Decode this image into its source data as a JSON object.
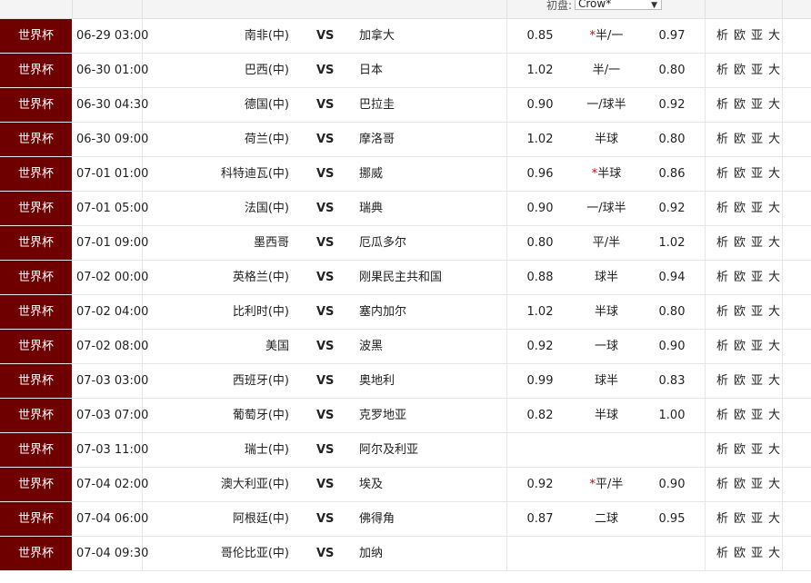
{
  "header": {
    "initial_label": "初盘:",
    "company_select": "Crow*"
  },
  "link_labels": [
    "析",
    "欧",
    "亚",
    "大"
  ],
  "vs_label": "VS",
  "matches": [
    {
      "league": "世界杯",
      "time": "06-29 03:00",
      "home": "南非(中)",
      "away": "加拿大",
      "odds_home": "0.85",
      "handicap": "半/一",
      "handicap_star": "*",
      "odds_away": "0.97"
    },
    {
      "league": "世界杯",
      "time": "06-30 01:00",
      "home": "巴西(中)",
      "away": "日本",
      "odds_home": "1.02",
      "handicap": "半/一",
      "handicap_star": "",
      "odds_away": "0.80"
    },
    {
      "league": "世界杯",
      "time": "06-30 04:30",
      "home": "德国(中)",
      "away": "巴拉圭",
      "odds_home": "0.90",
      "handicap": "一/球半",
      "handicap_star": "",
      "odds_away": "0.92"
    },
    {
      "league": "世界杯",
      "time": "06-30 09:00",
      "home": "荷兰(中)",
      "away": "摩洛哥",
      "odds_home": "1.02",
      "handicap": "半球",
      "handicap_star": "",
      "odds_away": "0.80"
    },
    {
      "league": "世界杯",
      "time": "07-01 01:00",
      "home": "科特迪瓦(中)",
      "away": "挪威",
      "odds_home": "0.96",
      "handicap": "半球",
      "handicap_star": "*",
      "odds_away": "0.86"
    },
    {
      "league": "世界杯",
      "time": "07-01 05:00",
      "home": "法国(中)",
      "away": "瑞典",
      "odds_home": "0.90",
      "handicap": "一/球半",
      "handicap_star": "",
      "odds_away": "0.92"
    },
    {
      "league": "世界杯",
      "time": "07-01 09:00",
      "home": "墨西哥",
      "away": "厄瓜多尔",
      "odds_home": "0.80",
      "handicap": "平/半",
      "handicap_star": "",
      "odds_away": "1.02"
    },
    {
      "league": "世界杯",
      "time": "07-02 00:00",
      "home": "英格兰(中)",
      "away": "刚果民主共和国",
      "odds_home": "0.88",
      "handicap": "球半",
      "handicap_star": "",
      "odds_away": "0.94"
    },
    {
      "league": "世界杯",
      "time": "07-02 04:00",
      "home": "比利时(中)",
      "away": "塞内加尔",
      "odds_home": "1.02",
      "handicap": "半球",
      "handicap_star": "",
      "odds_away": "0.80"
    },
    {
      "league": "世界杯",
      "time": "07-02 08:00",
      "home": "美国",
      "away": "波黑",
      "odds_home": "0.92",
      "handicap": "一球",
      "handicap_star": "",
      "odds_away": "0.90"
    },
    {
      "league": "世界杯",
      "time": "07-03 03:00",
      "home": "西班牙(中)",
      "away": "奥地利",
      "odds_home": "0.99",
      "handicap": "球半",
      "handicap_star": "",
      "odds_away": "0.83"
    },
    {
      "league": "世界杯",
      "time": "07-03 07:00",
      "home": "葡萄牙(中)",
      "away": "克罗地亚",
      "odds_home": "0.82",
      "handicap": "半球",
      "handicap_star": "",
      "odds_away": "1.00"
    },
    {
      "league": "世界杯",
      "time": "07-03 11:00",
      "home": "瑞士(中)",
      "away": "阿尔及利亚",
      "odds_home": "",
      "handicap": "",
      "handicap_star": "",
      "odds_away": ""
    },
    {
      "league": "世界杯",
      "time": "07-04 02:00",
      "home": "澳大利亚(中)",
      "away": "埃及",
      "odds_home": "0.92",
      "handicap": "平/半",
      "handicap_star": "*",
      "odds_away": "0.90"
    },
    {
      "league": "世界杯",
      "time": "07-04 06:00",
      "home": "阿根廷(中)",
      "away": "佛得角",
      "odds_home": "0.87",
      "handicap": "二球",
      "handicap_star": "",
      "odds_away": "0.95"
    },
    {
      "league": "世界杯",
      "time": "07-04 09:30",
      "home": "哥伦比亚(中)",
      "away": "加纳",
      "odds_home": "",
      "handicap": "",
      "handicap_star": "",
      "odds_away": ""
    }
  ]
}
